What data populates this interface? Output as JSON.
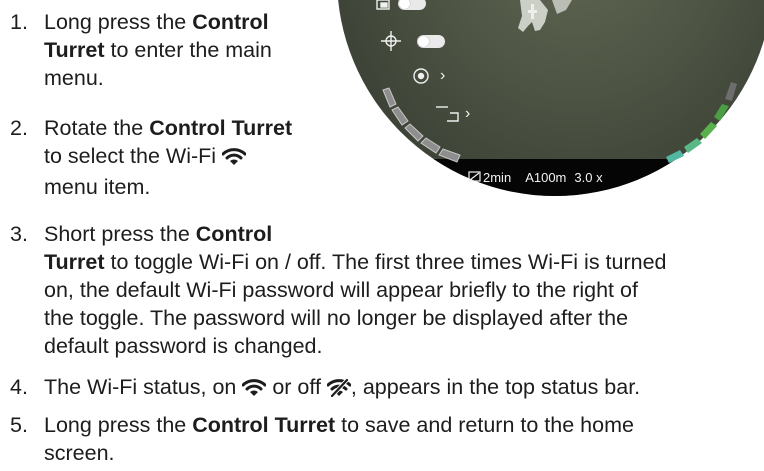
{
  "steps": [
    {
      "number": "1.",
      "lines": [
        [
          {
            "t": "Long press the "
          },
          {
            "t": "Control",
            "b": true
          }
        ],
        [
          {
            "t": "Turret",
            "b": true
          },
          {
            "t": " to enter the main"
          }
        ],
        [
          {
            "t": "menu."
          }
        ]
      ]
    },
    {
      "number": "2.",
      "lines": [
        [
          {
            "t": "Rotate the "
          },
          {
            "t": "Control Turret",
            "b": true
          }
        ],
        [
          {
            "t": "to select the Wi-Fi "
          },
          {
            "icon": "wifi-on"
          }
        ],
        [
          {
            "t": "menu item."
          }
        ]
      ]
    },
    {
      "number": "3.",
      "lines": [
        [
          {
            "t": "Short press the "
          },
          {
            "t": "Control",
            "b": true
          }
        ],
        [
          {
            "t": "Turret",
            "b": true
          },
          {
            "t": " to toggle Wi-Fi on / off. The first three times Wi-Fi is turned"
          }
        ],
        [
          {
            "t": "on, the default Wi-Fi password will appear briefly to the right of"
          }
        ],
        [
          {
            "t": "the toggle. The password will no longer be displayed after the"
          }
        ],
        [
          {
            "t": "default password is changed."
          }
        ]
      ]
    },
    {
      "number": "4.",
      "lines": [
        [
          {
            "t": "The Wi-Fi status, on "
          },
          {
            "icon": "wifi-on"
          },
          {
            "t": " or off "
          },
          {
            "icon": "wifi-off"
          },
          {
            "t": ", appears in the top status bar."
          }
        ]
      ]
    },
    {
      "number": "5.",
      "lines": [
        [
          {
            "t": "Long press the "
          },
          {
            "t": "Control Turret",
            "b": true
          },
          {
            "t": " to save and return to the home"
          }
        ],
        [
          {
            "t": "screen."
          }
        ]
      ]
    }
  ],
  "viewfinder": {
    "recording_time": "2min",
    "range": "A100m",
    "zoom": "3.0 x",
    "menu_icons": [
      "picture-in-picture-icon",
      "compass-icon",
      "brightness-icon",
      "bracket-icon"
    ],
    "colors": {
      "screen_bar": "#050505",
      "left_arc": "#9a9a9a",
      "right_arc_green": "#4fb85a",
      "right_arc_teal": "#4fc3b5"
    }
  }
}
